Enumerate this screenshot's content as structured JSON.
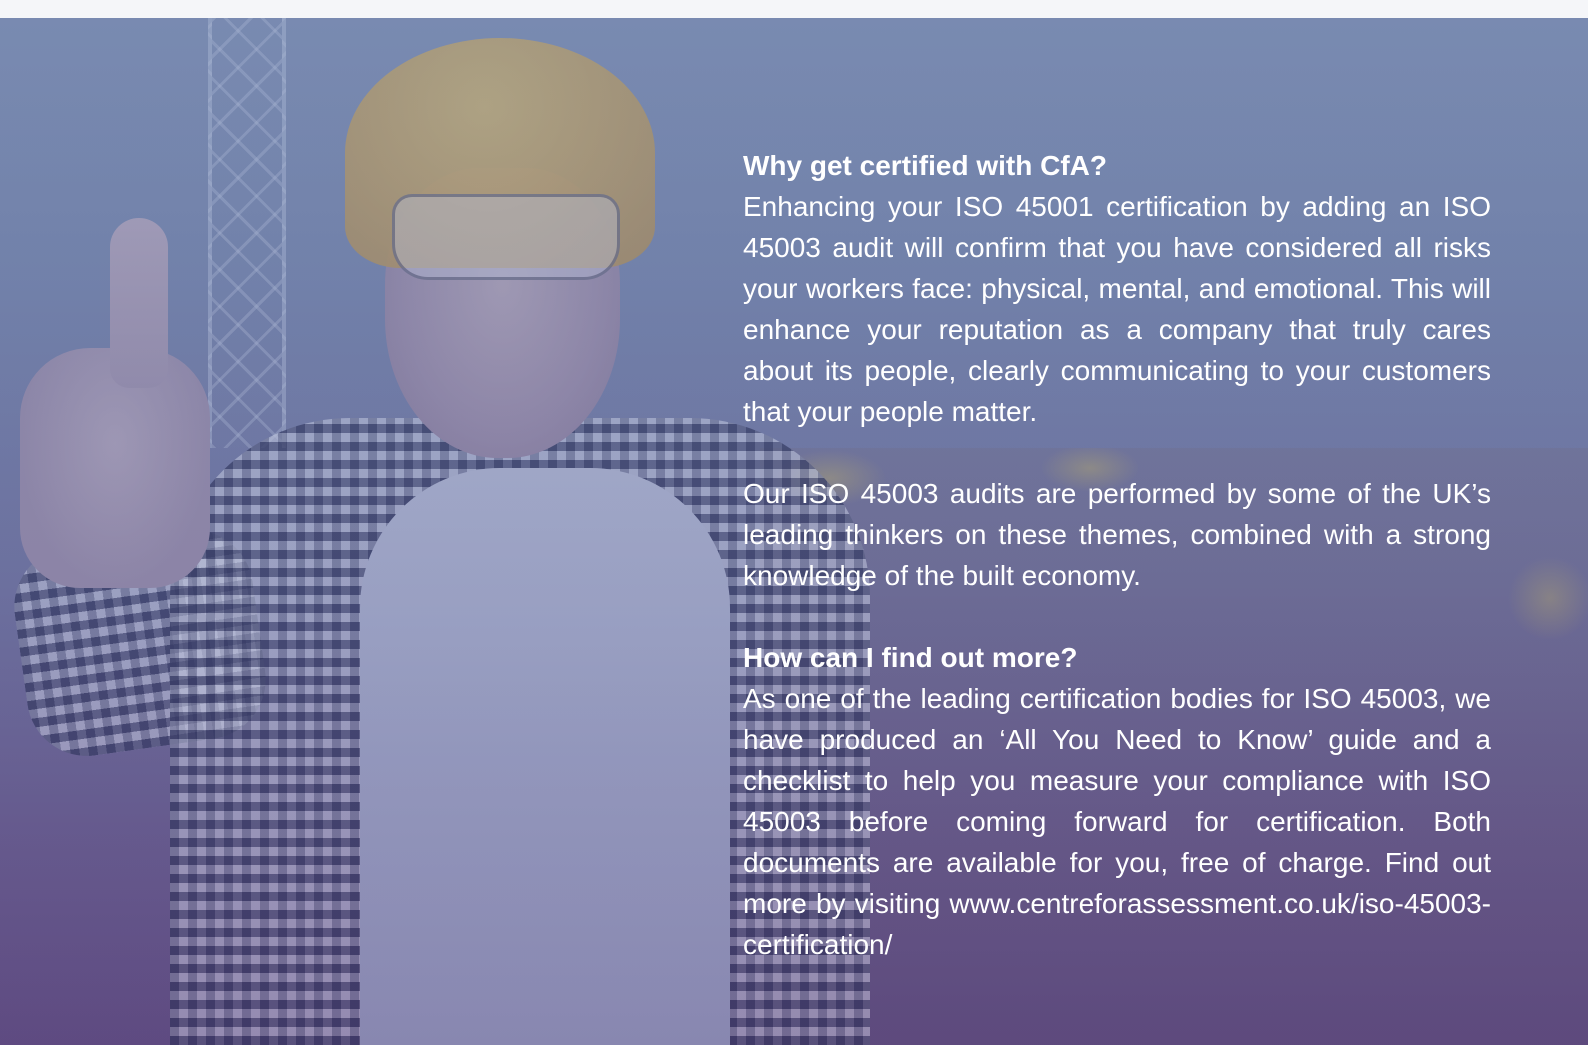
{
  "section_why": {
    "heading": "Why get certified with CfA?",
    "body": "Enhancing your ISO 45001 certification by adding an ISO 45003 audit will confirm that you have considered all risks your workers face: physical, mental, and emo­tional. This will enhance your reputation as a company that truly cares about its people, clearly communicat­ing to your customers that your people matter."
  },
  "section_audits": {
    "body": "Our ISO 45003 audits are performed by some of the UK’s leading thinkers on these themes, combined with a strong knowledge of the built economy."
  },
  "section_more": {
    "heading": "How can I find out more?",
    "body": "As one of the leading certification bodies for ISO 45003, we have produced an ‘All You Need to Know’ guide and a checklist to help you measure your compliance with ISO 45003 before coming forward for certification. Both documents are available for you, free of charge. Find out more by visiting www.centreforassessment.​co.uk/iso-45003-certification/"
  }
}
